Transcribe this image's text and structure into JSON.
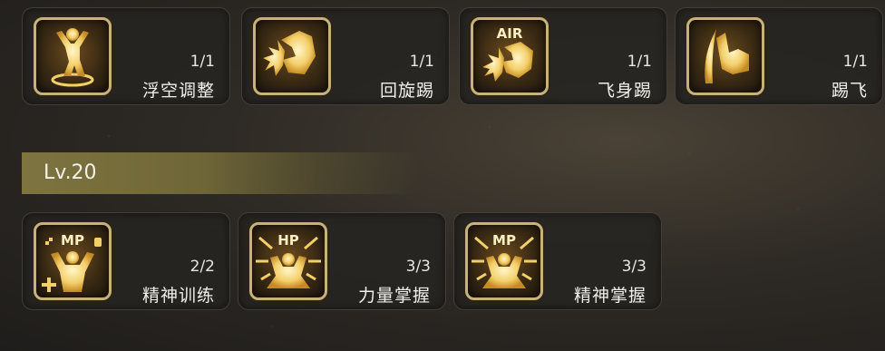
{
  "row1": [
    {
      "icon": "floating-figure-icon",
      "count": "1/1",
      "name": "浮空调整"
    },
    {
      "icon": "spin-kick-icon",
      "count": "1/1",
      "name": "回旋踢"
    },
    {
      "icon": "air-kick-icon",
      "icon_text": "AIR",
      "count": "1/1",
      "name": "飞身踢"
    },
    {
      "icon": "launch-kick-icon",
      "count": "1/1",
      "name": "踢飞"
    }
  ],
  "level_header": {
    "label": "Lv.20"
  },
  "row2": [
    {
      "icon": "mp-training-icon",
      "icon_text": "MP",
      "count": "2/2",
      "name": "精神训练"
    },
    {
      "icon": "hp-mastery-icon",
      "icon_text": "HP",
      "count": "3/3",
      "name": "力量掌握"
    },
    {
      "icon": "mp-mastery-icon",
      "icon_text": "MP",
      "count": "3/3",
      "name": "精神掌握"
    }
  ],
  "colors": {
    "icon_gold": "#f3cf6a",
    "icon_border": "#c9b27a",
    "level_bar": "#7e7440"
  }
}
